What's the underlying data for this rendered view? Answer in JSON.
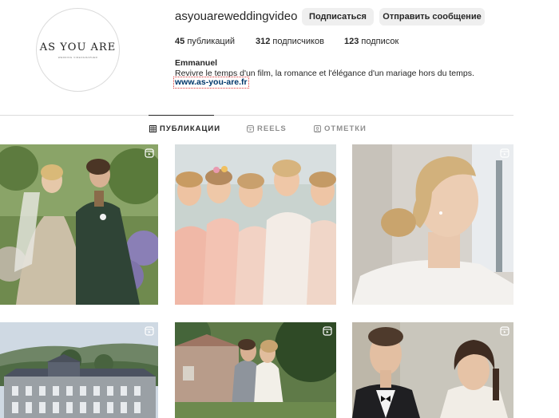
{
  "profile": {
    "username": "asyouareweddingvideo",
    "logo_text": "AS YOU ARE",
    "logo_subtext": "WEDDING VIDEOGRAPHER",
    "follow_label": "Подписаться",
    "message_label": "Отправить сообщение",
    "posts_count": "45",
    "posts_label": "публикаций",
    "followers_count": "312",
    "followers_label": "подписчиков",
    "following_count": "123",
    "following_label": "подписок",
    "bio_name": "Emmanuel",
    "bio_text": "Revivre le temps d'un film, la romance et l'élégance d'un mariage hors du temps.",
    "website": "www.as-you-are.fr"
  },
  "tabs": [
    {
      "label": "ПУБЛИКАЦИИ",
      "icon": "grid-icon",
      "active": true
    },
    {
      "label": "REELS",
      "icon": "reels-icon",
      "active": false
    },
    {
      "label": "ОТМЕТКИ",
      "icon": "tagged-icon",
      "active": false
    }
  ],
  "posts": [
    {
      "subject": "bride and groom in garden",
      "icon": "reel-icon"
    },
    {
      "subject": "bride with bridesmaids",
      "icon": "reel-icon"
    },
    {
      "subject": "bride profile portrait",
      "icon": "reel-icon"
    },
    {
      "subject": "chateau landscape",
      "icon": "reel-icon"
    },
    {
      "subject": "couple kissing near house",
      "icon": "reel-icon"
    },
    {
      "subject": "couple portrait",
      "icon": "reel-icon"
    }
  ],
  "colors": {
    "button_bg": "#efefef",
    "link": "#00376b",
    "divider": "#dbdbdb",
    "muted": "#8e8e8e"
  }
}
